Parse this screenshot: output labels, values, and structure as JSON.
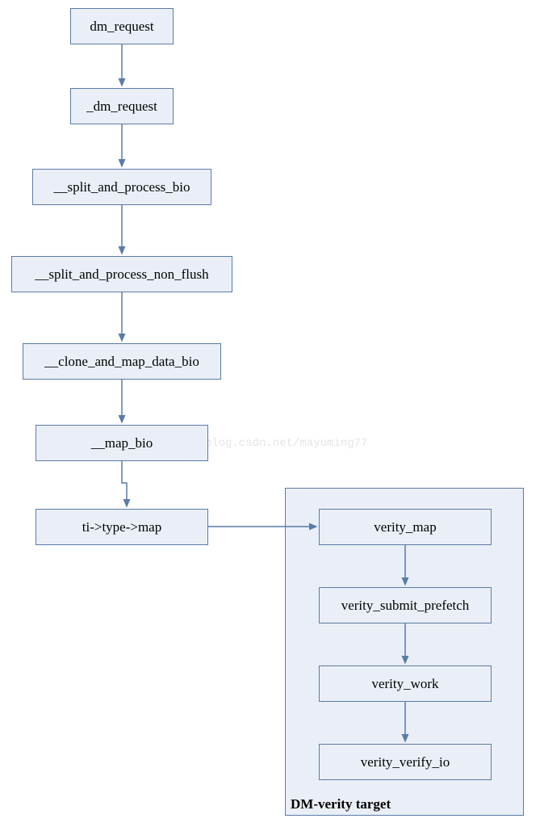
{
  "nodes": {
    "n1": "dm_request",
    "n2": "_dm_request",
    "n3": "__split_and_process_bio",
    "n4": "__split_and_process_non_flush",
    "n5": "__clone_and_map_data_bio",
    "n6": "__map_bio",
    "n7": "ti->type->map",
    "v1": "verity_map",
    "v2": "verity_submit_prefetch",
    "v3": "verity_work",
    "v4": "verity_verify_io"
  },
  "group_label": "DM-verity target",
  "watermark": "http://blog.csdn.net/mayuming77",
  "colors": {
    "box_fill": "#eaeff7",
    "box_border": "#5a7ba8",
    "arrow": "#5a7ba8"
  }
}
